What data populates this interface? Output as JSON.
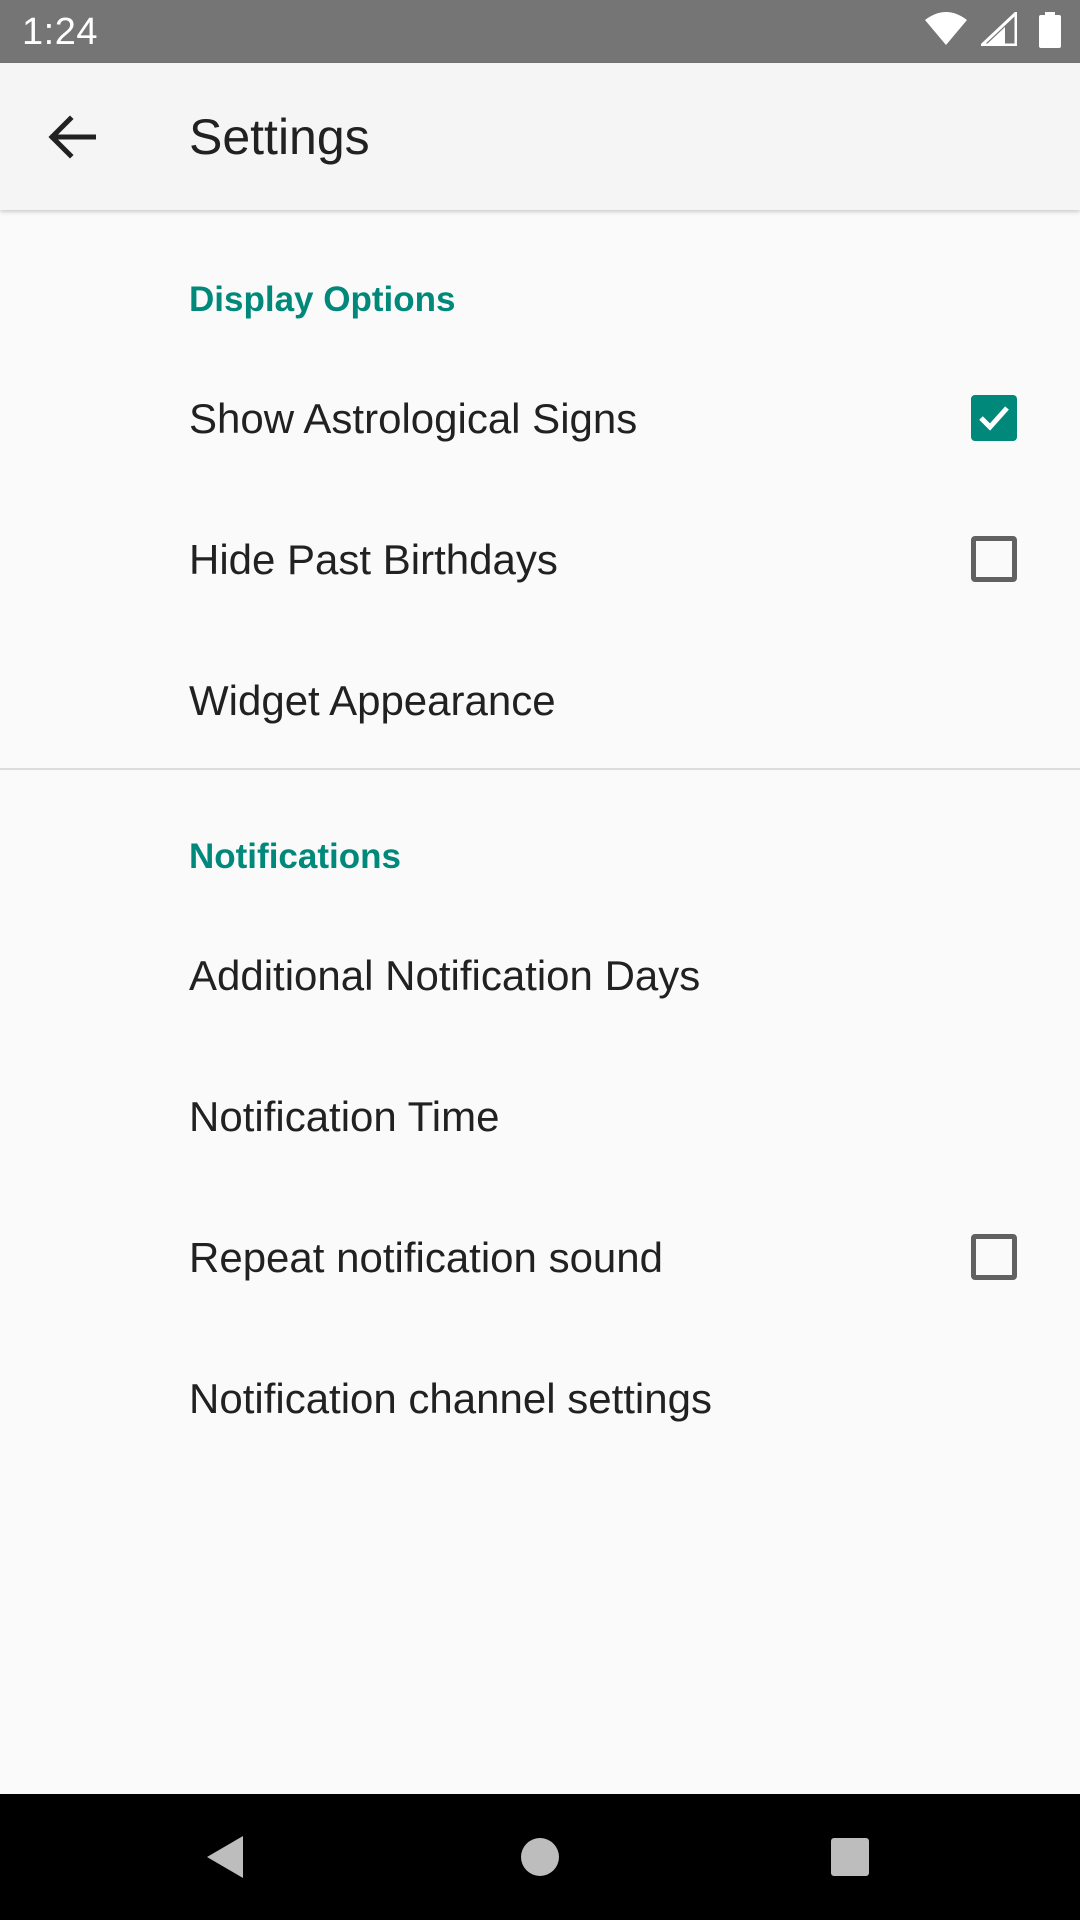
{
  "status_bar": {
    "time": "1:24",
    "icons": [
      "wifi-icon",
      "signal-icon",
      "battery-icon"
    ]
  },
  "app_bar": {
    "back_icon": "arrow-back-icon",
    "title": "Settings"
  },
  "sections": {
    "display": {
      "header": "Display Options",
      "show_signs": {
        "label": "Show Astrological Signs",
        "checked": true
      },
      "hide_past": {
        "label": "Hide Past Birthdays",
        "checked": false
      },
      "widget": {
        "label": "Widget Appearance"
      }
    },
    "notifications": {
      "header": "Notifications",
      "additional_days": {
        "label": "Additional Notification Days"
      },
      "time": {
        "label": "Notification Time"
      },
      "repeat_sound": {
        "label": "Repeat notification sound",
        "checked": false
      },
      "channel": {
        "label": "Notification channel settings"
      }
    }
  },
  "nav_bar": {
    "buttons": [
      "back-triangle-icon",
      "home-circle-icon",
      "recents-square-icon"
    ]
  },
  "colors": {
    "accent": "#00897b",
    "status_bar": "#757575",
    "app_bar": "#f5f5f5",
    "background": "#fafafa",
    "nav_bar": "#000000"
  }
}
